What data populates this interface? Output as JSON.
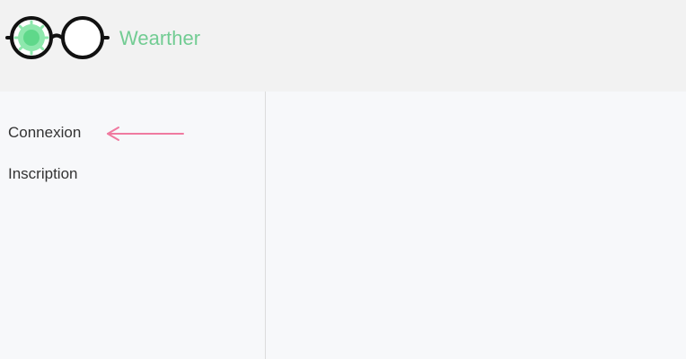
{
  "header": {
    "brand": "Wearther",
    "logo_icon": "glasses-sun-icon",
    "brand_color": "#72cc93"
  },
  "sidebar": {
    "items": [
      {
        "label": "Connexion"
      },
      {
        "label": "Inscription"
      }
    ],
    "pointer_icon": "arrow-left-icon",
    "pointer_color": "#f07aa0"
  }
}
